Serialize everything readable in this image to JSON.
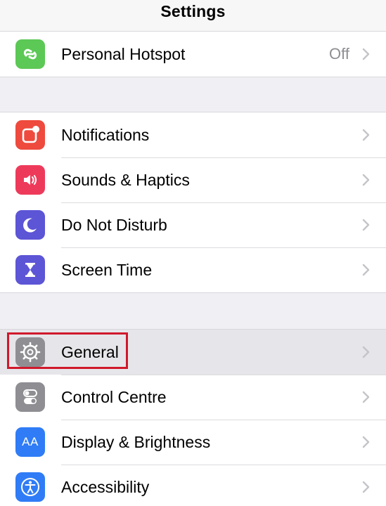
{
  "nav": {
    "title": "Settings"
  },
  "groups": [
    {
      "rows": [
        {
          "label": "Personal Hotspot",
          "value": "Off",
          "icon": "personal-hotspot-icon",
          "color": "#5cc855"
        }
      ]
    },
    {
      "rows": [
        {
          "label": "Notifications",
          "icon": "notifications-icon",
          "color": "#ee4a3e"
        },
        {
          "label": "Sounds & Haptics",
          "icon": "speaker-icon",
          "color": "#ee3a5a"
        },
        {
          "label": "Do Not Disturb",
          "icon": "moon-icon",
          "color": "#5c55d6"
        },
        {
          "label": "Screen Time",
          "icon": "hourglass-icon",
          "color": "#5c55d6"
        }
      ]
    },
    {
      "rows": [
        {
          "label": "General",
          "icon": "gear-icon",
          "color": "#8e8e93",
          "highlighted": true
        },
        {
          "label": "Control Centre",
          "icon": "toggles-icon",
          "color": "#8e8e93"
        },
        {
          "label": "Display & Brightness",
          "icon": "display-aa-icon",
          "color": "#2f7cf6",
          "icon_text": "AA"
        },
        {
          "label": "Accessibility",
          "icon": "accessibility-icon",
          "color": "#2f7cf6"
        }
      ]
    }
  ],
  "highlight_color": "#d0192c"
}
